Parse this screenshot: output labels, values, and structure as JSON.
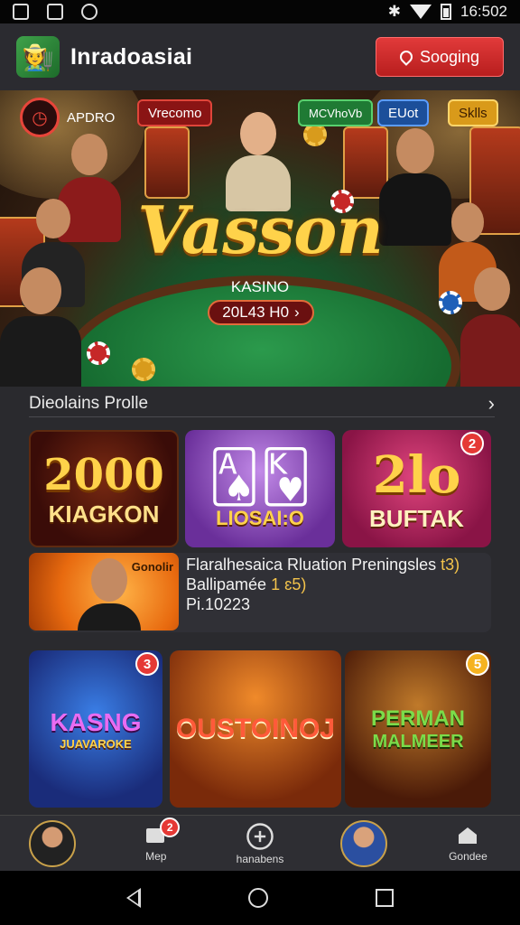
{
  "status_bar": {
    "time": "16:502"
  },
  "header": {
    "app_title": "Inradoasiai",
    "login_label": "Sooging"
  },
  "hero": {
    "corner_label": "APDRO",
    "pill_welcome": "Vrecomo",
    "pill_one": "MCVhoVb",
    "pill_two": "EUot",
    "pill_three": "Sklls",
    "title": "Vasson",
    "subtitle": "KASINO",
    "cta_label": "20L43 H0"
  },
  "section": {
    "title": "Dieolains Prolle"
  },
  "games_row1": [
    {
      "big": "2000",
      "caption": "KIAGKON"
    },
    {
      "caption": "LIOSAI:O"
    },
    {
      "big": "2lo",
      "caption": "BUFTAK",
      "badge": "2"
    }
  ],
  "promo": {
    "tag": "Gonolir",
    "line1": "Flaralhesaica Rluation Preningsles",
    "line1_extra": "t3)",
    "line2": "Ballipamée",
    "line2_extra": "1 ɛ5)",
    "line3": "Pi.10223"
  },
  "games_row2": [
    {
      "caption": "KASNG",
      "subcaption": "JUAVAROKE",
      "badge": "3"
    },
    {
      "caption": "OUSTOINOJ"
    },
    {
      "caption": "PERMAN",
      "subcaption": "MALMEER",
      "badge": "5"
    }
  ],
  "bottom_nav": [
    {
      "label": ""
    },
    {
      "label": "Mep",
      "badge": "2"
    },
    {
      "label": "hanabens"
    },
    {
      "label": ""
    },
    {
      "label": "Gondee"
    }
  ],
  "colors": {
    "accent": "#e23a3a",
    "gold": "#ffd24a",
    "felt": "#1f6e35"
  }
}
